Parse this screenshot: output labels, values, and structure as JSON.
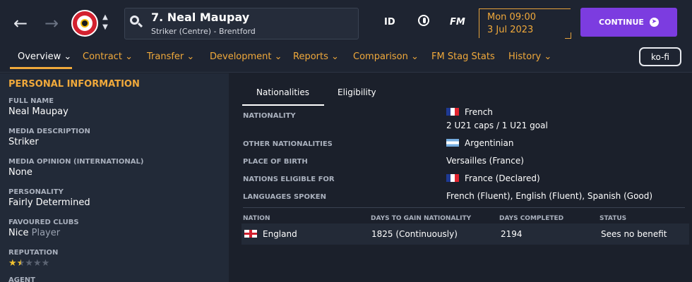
{
  "header": {
    "player_title": "7. Neal Maupay",
    "player_subtitle": "Striker (Centre) - Brentford",
    "icons": {
      "id": "ID",
      "fm": "FM"
    },
    "date_day": "Mon 09:00",
    "date_date": "3 Jul 2023",
    "continue_label": "CONTINUE"
  },
  "tabs": [
    {
      "label": "Overview"
    },
    {
      "label": "Contract"
    },
    {
      "label": "Transfer"
    },
    {
      "label": "Development"
    },
    {
      "label": "Reports"
    },
    {
      "label": "Comparison"
    },
    {
      "label": "FM Stag Stats"
    },
    {
      "label": "History"
    }
  ],
  "kofi_label": "ko-fi",
  "personal": {
    "title": "PERSONAL INFORMATION",
    "full_name_label": "FULL NAME",
    "full_name": "Neal Maupay",
    "media_desc_label": "MEDIA DESCRIPTION",
    "media_desc": "Striker",
    "media_opinion_label": "MEDIA OPINION (INTERNATIONAL)",
    "media_opinion": "None",
    "personality_label": "PERSONALITY",
    "personality": "Fairly Determined",
    "favoured_clubs_label": "FAVOURED CLUBS",
    "favoured_clubs_value": "Nice",
    "favoured_clubs_role": "Player",
    "reputation_label": "REPUTATION",
    "reputation_stars": 1.5,
    "agent_label": "AGENT"
  },
  "main": {
    "tabs": [
      {
        "label": "Nationalities"
      },
      {
        "label": "Eligibility"
      }
    ],
    "rows": {
      "nationality_label": "NATIONALITY",
      "nationality": "French",
      "caps": "2 U21 caps / 1 U21 goal",
      "other_label": "OTHER NATIONALITIES",
      "other": "Argentinian",
      "birth_label": "PLACE OF BIRTH",
      "birth": "Versailles (France)",
      "eligible_label": "NATIONS ELIGIBLE FOR",
      "eligible": "France (Declared)",
      "languages_label": "LANGUAGES SPOKEN",
      "languages": "French (Fluent), English (Fluent), Spanish (Good)"
    },
    "table": {
      "columns": [
        "NATION",
        "DAYS TO GAIN NATIONALITY",
        "DAYS COMPLETED",
        "STATUS"
      ],
      "rows": [
        {
          "nation": "England",
          "days_to_gain": "1825 (Continuously)",
          "days_completed": "2194",
          "status": "Sees no benefit"
        }
      ]
    }
  },
  "colors": {
    "accent": "#f0a93b",
    "continue": "#7c3ce0",
    "background": "#1a1f2b"
  }
}
